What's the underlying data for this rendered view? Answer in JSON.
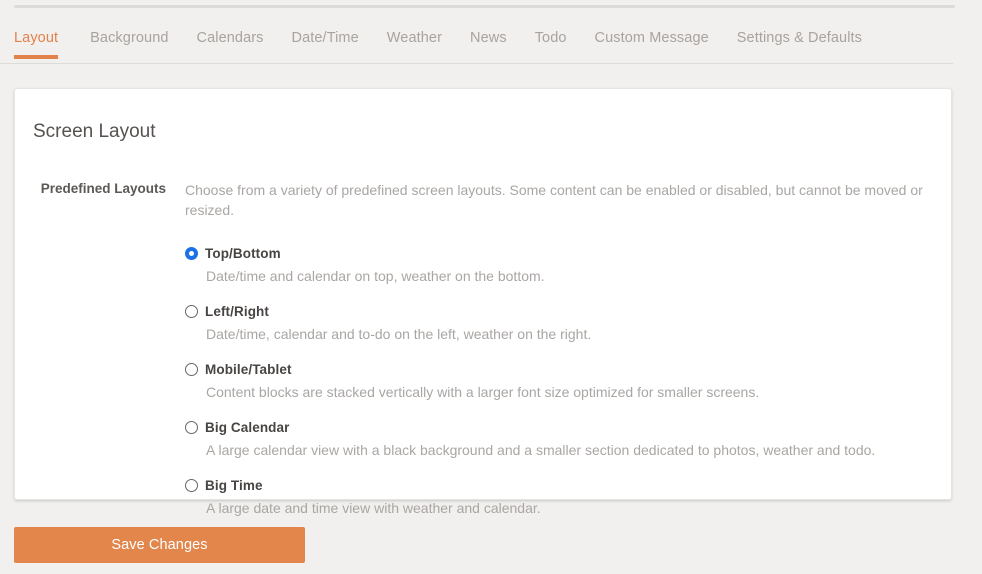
{
  "theme": {
    "accent": "#e2824a",
    "page_bg": "#f1f0ee",
    "card_bg": "#ffffff",
    "radio_selected": "#1b72e8",
    "muted_text": "#a9a6a3"
  },
  "tabs": [
    {
      "label": "Layout",
      "active": true
    },
    {
      "label": "Background",
      "active": false
    },
    {
      "label": "Calendars",
      "active": false
    },
    {
      "label": "Date/Time",
      "active": false
    },
    {
      "label": "Weather",
      "active": false
    },
    {
      "label": "News",
      "active": false
    },
    {
      "label": "Todo",
      "active": false
    },
    {
      "label": "Custom Message",
      "active": false
    },
    {
      "label": "Settings & Defaults",
      "active": false
    }
  ],
  "card": {
    "title": "Screen Layout",
    "field_label": "Predefined Layouts",
    "help_text": "Choose from a variety of predefined screen layouts. Some content can be enabled or disabled, but cannot be moved or resized.",
    "options": [
      {
        "label": "Top/Bottom",
        "description": "Date/time and calendar on top, weather on the bottom.",
        "selected": true
      },
      {
        "label": "Left/Right",
        "description": "Date/time, calendar and to-do on the left, weather on the right.",
        "selected": false
      },
      {
        "label": "Mobile/Tablet",
        "description": "Content blocks are stacked vertically with a larger font size optimized for smaller screens.",
        "selected": false
      },
      {
        "label": "Big Calendar",
        "description": "A large calendar view with a black background and a smaller section dedicated to photos, weather and todo.",
        "selected": false
      },
      {
        "label": "Big Time",
        "description": "A large date and time view with weather and calendar.",
        "selected": false
      }
    ]
  },
  "actions": {
    "save_label": "Save Changes"
  }
}
